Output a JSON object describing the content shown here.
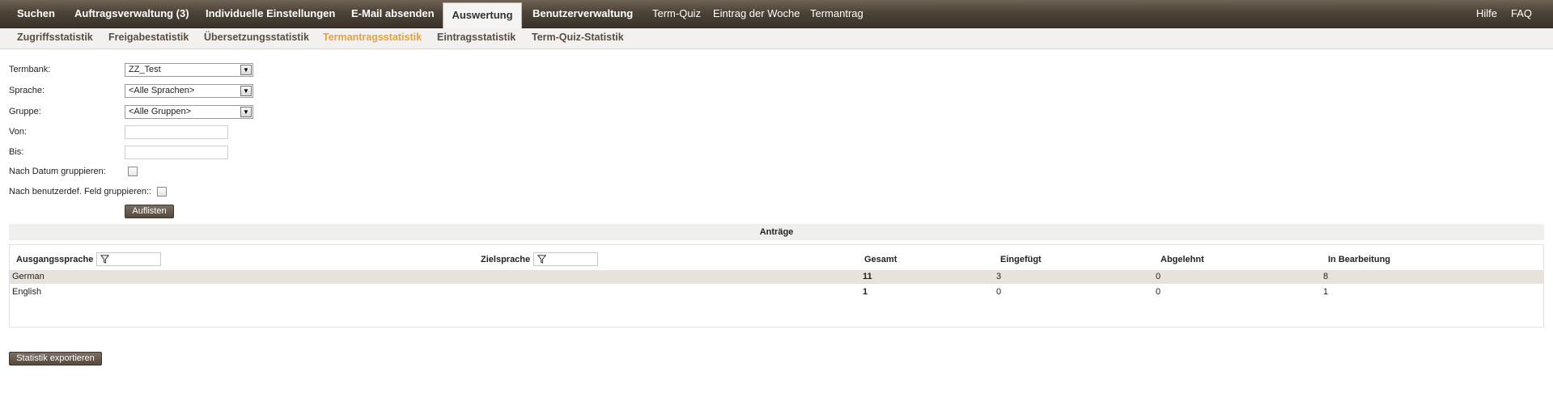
{
  "topnav": {
    "items": [
      {
        "label": "Suchen"
      },
      {
        "label": "Auftragsverwaltung (3)"
      },
      {
        "label": "Individuelle Einstellungen"
      },
      {
        "label": "E-Mail absenden"
      },
      {
        "label": "Auswertung",
        "active": true
      },
      {
        "label": "Benutzerverwaltung"
      },
      {
        "label": "Term-Quiz"
      },
      {
        "label": "Eintrag der Woche"
      },
      {
        "label": "Termantrag"
      }
    ],
    "right": [
      {
        "label": "Hilfe"
      },
      {
        "label": "FAQ"
      }
    ]
  },
  "subnav": {
    "items": [
      {
        "label": "Zugriffsstatistik"
      },
      {
        "label": "Freigabestatistik"
      },
      {
        "label": "Übersetzungsstatistik"
      },
      {
        "label": "Termantragsstatistik",
        "active": true
      },
      {
        "label": "Eintragsstatistik"
      },
      {
        "label": "Term-Quiz-Statistik"
      }
    ]
  },
  "form": {
    "termbank_label": "Termbank:",
    "termbank_value": "ZZ_Test",
    "sprache_label": "Sprache:",
    "sprache_value": "<Alle Sprachen>",
    "gruppe_label": "Gruppe:",
    "gruppe_value": "<Alle Gruppen>",
    "von_label": "Von:",
    "von_value": "",
    "bis_label": "Bis:",
    "bis_value": "",
    "nach_datum_label": "Nach Datum gruppieren:",
    "nach_feld_label": "Nach benutzerdef. Feld gruppieren::",
    "submit_label": "Auflisten"
  },
  "results": {
    "title": "Anträge",
    "columns": [
      "Ausgangssprache",
      "Zielsprache",
      "Gesamt",
      "Eingefügt",
      "Abgelehnt",
      "In Bearbeitung"
    ],
    "rows": [
      {
        "source": "German",
        "target": "",
        "total": "11",
        "inserted": "3",
        "rejected": "0",
        "in_progress": "8"
      },
      {
        "source": "English",
        "target": "",
        "total": "1",
        "inserted": "0",
        "rejected": "0",
        "in_progress": "1"
      }
    ]
  },
  "export_label": "Statistik exportieren",
  "colors": {
    "nav_bg": "#4c4237",
    "sub_active": "#e8a13a",
    "highlight_row": "#e8e2dc",
    "button": "#6a5d50"
  }
}
